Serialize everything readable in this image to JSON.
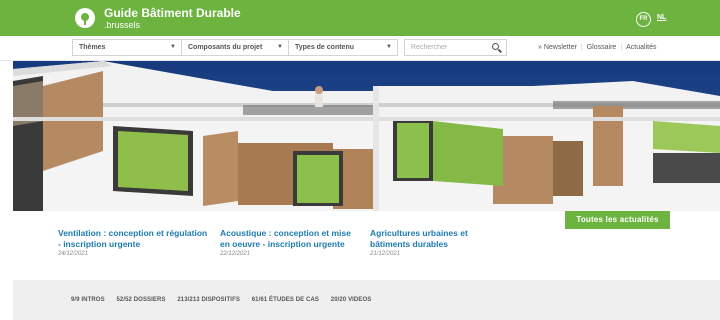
{
  "header": {
    "site_title": "Guide Bâtiment Durable",
    "site_subtitle": ".brussels",
    "lang_fr": "FR",
    "lang_nl": "NL",
    "brand_color": "#6cb33f"
  },
  "nav": {
    "themes": "Thèmes",
    "components": "Composants du projet",
    "content_types": "Types de contenu",
    "search_placeholder": "Rechercher",
    "links": [
      "» Newsletter",
      "Glossaire",
      "Actualités"
    ]
  },
  "hero": {
    "cta_label": "Toutes les actualités"
  },
  "news": [
    {
      "title": "Ventilation : conception et régulation - inscription urgente",
      "date": "24/12/2021"
    },
    {
      "title": "Acoustique : conception et mise en oeuvre - inscription urgente",
      "date": "22/12/2021"
    },
    {
      "title": "Agricultures urbaines et bâtiments durables",
      "date": "21/12/2021"
    }
  ],
  "stats": [
    "9/9 INTROS",
    "52/52 DOSSIERS",
    "213/213 DISPOSITIFS",
    "61/61 ÉTUDES DE CAS",
    "20/20 VIDEOS"
  ]
}
